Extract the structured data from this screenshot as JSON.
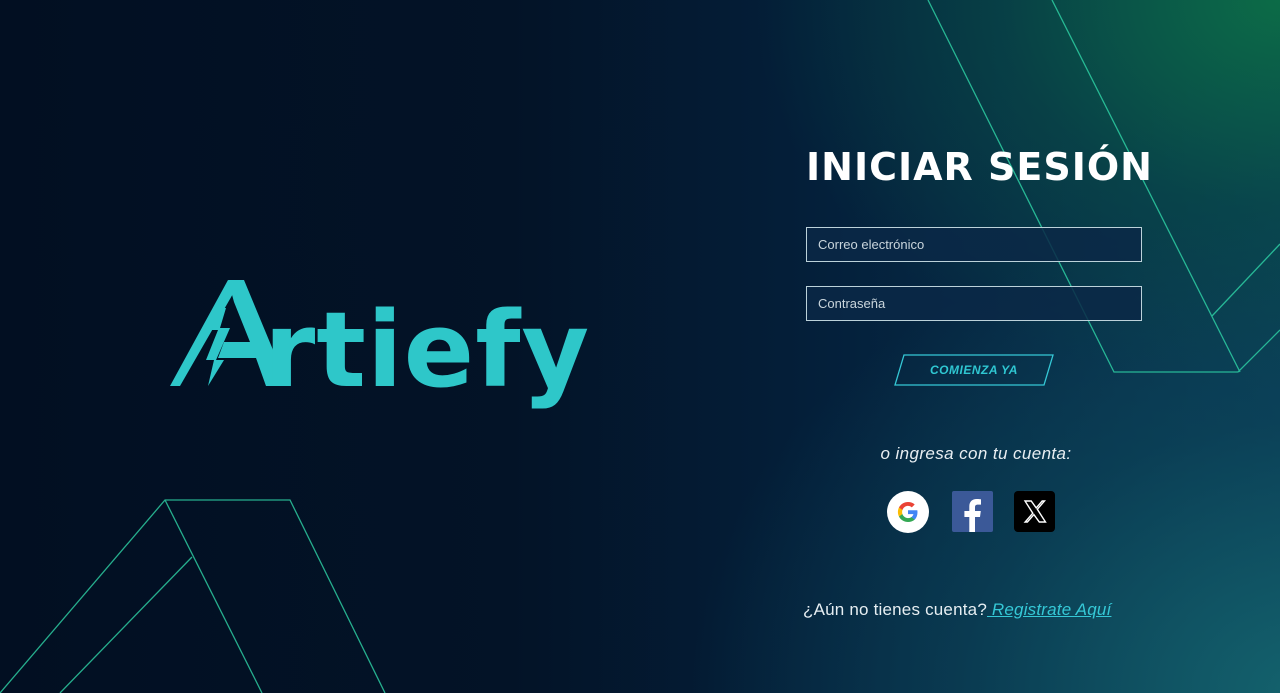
{
  "brand": {
    "name": "Artiefy",
    "color": "#2ec7c9"
  },
  "login": {
    "title": "INICIAR SESIÓN",
    "email_placeholder": "Correo electrónico",
    "password_placeholder": "Contraseña",
    "submit_label": "COMIENZA YA"
  },
  "social": {
    "prompt": "o ingresa con tu cuenta:",
    "providers": [
      {
        "name": "Google",
        "icon": "google-icon"
      },
      {
        "name": "Facebook",
        "icon": "facebook-icon"
      },
      {
        "name": "X",
        "icon": "x-icon"
      }
    ]
  },
  "signup": {
    "question": "¿Aún no tienes cuenta?",
    "link_label": " Registrate Aquí"
  },
  "colors": {
    "accent": "#35c8d6",
    "line": "#2fd6a8",
    "background_dark": "#031327"
  }
}
